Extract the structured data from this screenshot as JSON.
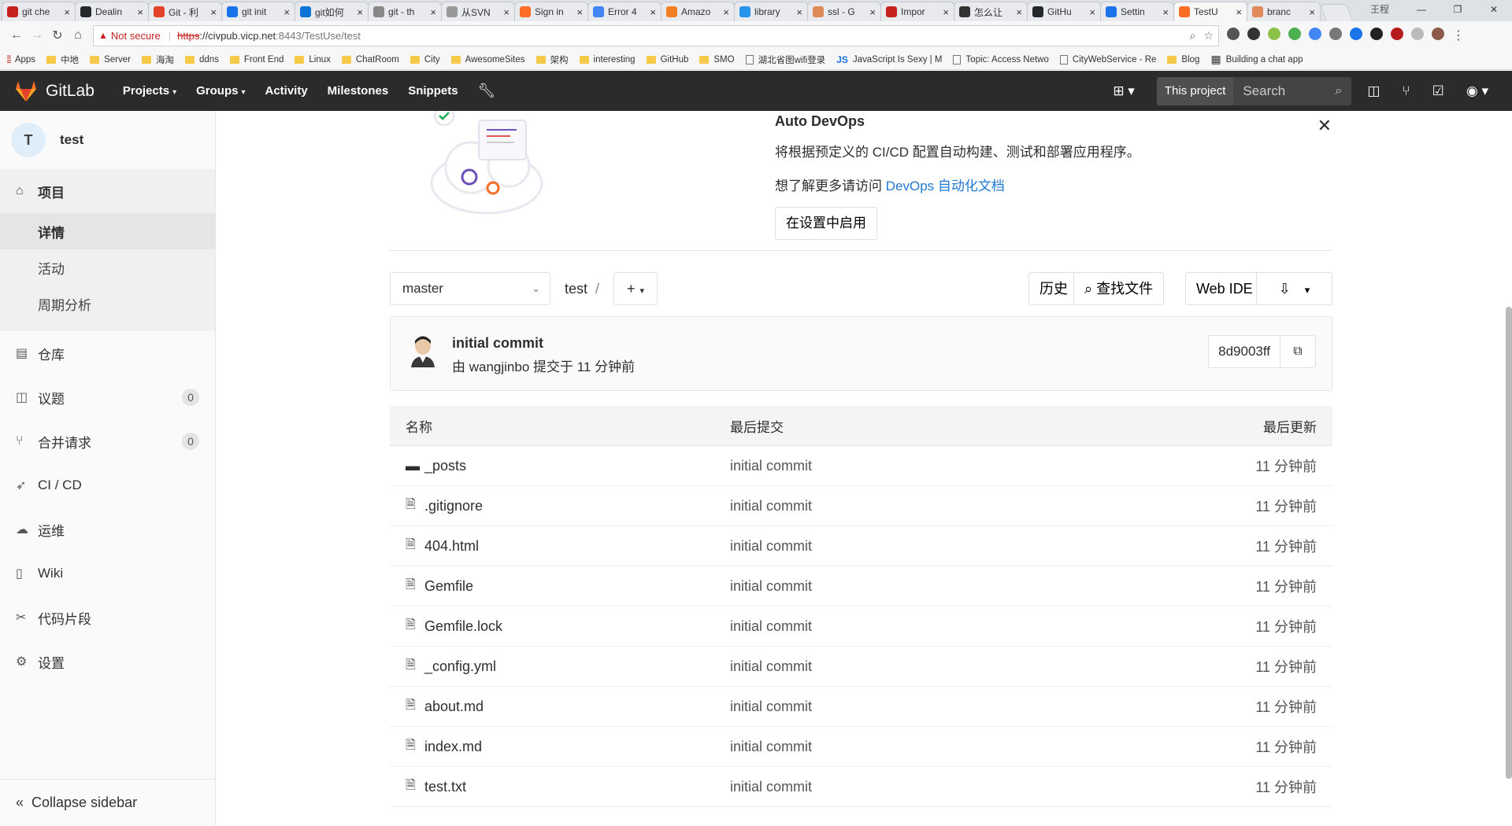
{
  "browser": {
    "tabs": [
      {
        "title": "git che",
        "color": "#c5221f",
        "active": false
      },
      {
        "title": "Dealin",
        "color": "#24292e",
        "active": false
      },
      {
        "title": "Git - 利",
        "color": "#e24329",
        "active": false
      },
      {
        "title": "git init",
        "color": "#1a73e8",
        "active": false
      },
      {
        "title": "git如何",
        "color": "#0c74d6",
        "active": false
      },
      {
        "title": "git - th",
        "color": "#888888",
        "active": false
      },
      {
        "title": "从SVN",
        "color": "#999999",
        "active": false
      },
      {
        "title": "Sign in",
        "color": "#fc6d26",
        "active": false
      },
      {
        "title": "Error 4",
        "color": "#4285f4",
        "active": false
      },
      {
        "title": "Amazo",
        "color": "#f48024",
        "active": false
      },
      {
        "title": "library",
        "color": "#2496ed",
        "active": false
      },
      {
        "title": "ssl - G",
        "color": "#e08a5a",
        "active": false
      },
      {
        "title": "Impor",
        "color": "#c5221f",
        "active": false
      },
      {
        "title": "怎么让",
        "color": "#333333",
        "active": false
      },
      {
        "title": "GitHu",
        "color": "#24292e",
        "active": false
      },
      {
        "title": "Settin",
        "color": "#1a73e8",
        "active": false
      },
      {
        "title": "TestU",
        "color": "#fc6d26",
        "active": true
      },
      {
        "title": "branc",
        "color": "#e08a5a",
        "active": false
      }
    ],
    "window_label": "王程",
    "security_label": "Not secure",
    "url_proto": "https",
    "url_host": "://civpub.vicp.net",
    "url_path": ":8443/TestUse/test",
    "bookmarks": [
      {
        "label": "Apps",
        "kind": "apps"
      },
      {
        "label": "中地",
        "kind": "folder"
      },
      {
        "label": "Server",
        "kind": "folder"
      },
      {
        "label": "海淘",
        "kind": "folder"
      },
      {
        "label": "ddns",
        "kind": "folder"
      },
      {
        "label": "Front End",
        "kind": "folder"
      },
      {
        "label": "Linux",
        "kind": "folder"
      },
      {
        "label": "ChatRoom",
        "kind": "folder"
      },
      {
        "label": "City",
        "kind": "folder"
      },
      {
        "label": "AwesomeSites",
        "kind": "folder"
      },
      {
        "label": "架构",
        "kind": "folder"
      },
      {
        "label": "interesting",
        "kind": "folder"
      },
      {
        "label": "GitHub",
        "kind": "folder"
      },
      {
        "label": "SMO",
        "kind": "folder"
      },
      {
        "label": "湖北省图wifi登录",
        "kind": "page"
      },
      {
        "label": "JavaScript Is Sexy | M",
        "kind": "js"
      },
      {
        "label": "Topic: Access Netwo",
        "kind": "page"
      },
      {
        "label": "CityWebService - Re",
        "kind": "page"
      },
      {
        "label": "Blog",
        "kind": "folder"
      },
      {
        "label": "Building a chat app",
        "kind": "grid"
      }
    ]
  },
  "header": {
    "brand": "GitLab",
    "nav": [
      {
        "label": "Projects",
        "dropdown": true
      },
      {
        "label": "Groups",
        "dropdown": true
      },
      {
        "label": "Activity",
        "dropdown": false
      },
      {
        "label": "Milestones",
        "dropdown": false
      },
      {
        "label": "Snippets",
        "dropdown": false
      }
    ],
    "search_scope": "This project",
    "search_placeholder": "Search"
  },
  "sidebar": {
    "project_initial": "T",
    "project_name": "test",
    "section_project": "项目",
    "sub_details": "详情",
    "sub_activity": "活动",
    "sub_cycle": "周期分析",
    "items": [
      {
        "label": "仓库",
        "icon": "repo-icon",
        "glyph": "▤",
        "badge": ""
      },
      {
        "label": "议题",
        "icon": "issues-icon",
        "glyph": "◫",
        "badge": "0"
      },
      {
        "label": "合并请求",
        "icon": "merge-request-icon",
        "glyph": "⑂",
        "badge": "0"
      },
      {
        "label": "CI / CD",
        "icon": "rocket-icon",
        "glyph": "➶",
        "badge": ""
      },
      {
        "label": "运维",
        "icon": "cloud-gear-icon",
        "glyph": "☁",
        "badge": ""
      },
      {
        "label": "Wiki",
        "icon": "book-icon",
        "glyph": "▯",
        "badge": ""
      },
      {
        "label": "代码片段",
        "icon": "scissors-icon",
        "glyph": "✂",
        "badge": ""
      },
      {
        "label": "设置",
        "icon": "settings-icon",
        "glyph": "⚙",
        "badge": ""
      }
    ],
    "collapse_label": "Collapse sidebar"
  },
  "devops": {
    "title": "Auto DevOps",
    "description": "将根据预定义的 CI/CD 配置自动构建、测试和部署应用程序。",
    "learn_prefix": "想了解更多请访问 ",
    "learn_link": "DevOps 自动化文档",
    "enable_button": "在设置中启用"
  },
  "toolbar": {
    "branch": "master",
    "path": "test",
    "history": "历史",
    "find_file": "查找文件",
    "web_ide": "Web IDE"
  },
  "commit": {
    "message": "initial commit",
    "meta": "由 wangjinbo 提交于 11 分钟前",
    "sha": "8d9003ff"
  },
  "files": {
    "headers": {
      "name": "名称",
      "last_commit": "最后提交",
      "last_update": "最后更新"
    },
    "rows": [
      {
        "name": "_posts",
        "type": "folder",
        "commit": "initial commit",
        "updated": "11 分钟前"
      },
      {
        "name": ".gitignore",
        "type": "file",
        "commit": "initial commit",
        "updated": "11 分钟前"
      },
      {
        "name": "404.html",
        "type": "file",
        "commit": "initial commit",
        "updated": "11 分钟前"
      },
      {
        "name": "Gemfile",
        "type": "file",
        "commit": "initial commit",
        "updated": "11 分钟前"
      },
      {
        "name": "Gemfile.lock",
        "type": "file",
        "commit": "initial commit",
        "updated": "11 分钟前"
      },
      {
        "name": "_config.yml",
        "type": "file",
        "commit": "initial commit",
        "updated": "11 分钟前"
      },
      {
        "name": "about.md",
        "type": "file",
        "commit": "initial commit",
        "updated": "11 分钟前"
      },
      {
        "name": "index.md",
        "type": "file",
        "commit": "initial commit",
        "updated": "11 分钟前"
      },
      {
        "name": "test.txt",
        "type": "file",
        "commit": "initial commit",
        "updated": "11 分钟前"
      }
    ]
  }
}
